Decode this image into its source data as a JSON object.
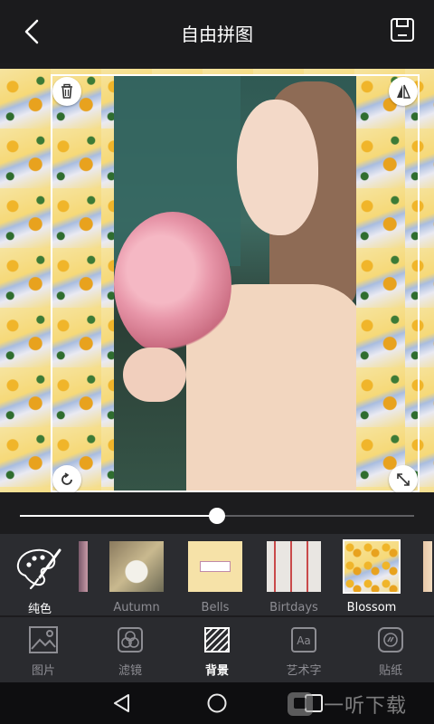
{
  "header": {
    "title": "自由拼图",
    "back_icon": "chevron-left-icon",
    "save_icon": "save-icon"
  },
  "editor": {
    "handles": [
      "trash-icon",
      "flip-icon",
      "rotate-icon",
      "resize-icon"
    ],
    "slider_value": 0.5
  },
  "backgrounds": {
    "solid_label": "纯色",
    "items": [
      {
        "label": "Autumn"
      },
      {
        "label": "Bells"
      },
      {
        "label": "Birtdays"
      },
      {
        "label": "Blossom",
        "selected": true
      }
    ]
  },
  "toolbar": {
    "items": [
      {
        "label": "图片",
        "icon": "image-icon"
      },
      {
        "label": "滤镜",
        "icon": "filter-icon"
      },
      {
        "label": "背景",
        "icon": "background-icon",
        "active": true
      },
      {
        "label": "艺术字",
        "icon": "text-art-icon"
      },
      {
        "label": "贴纸",
        "icon": "sticker-icon"
      }
    ]
  },
  "system_nav": {
    "watermark_text": "一听下载"
  },
  "colors": {
    "background": "#1c1c1e",
    "strip": "#2b2c30",
    "accent": "#ffffff"
  }
}
